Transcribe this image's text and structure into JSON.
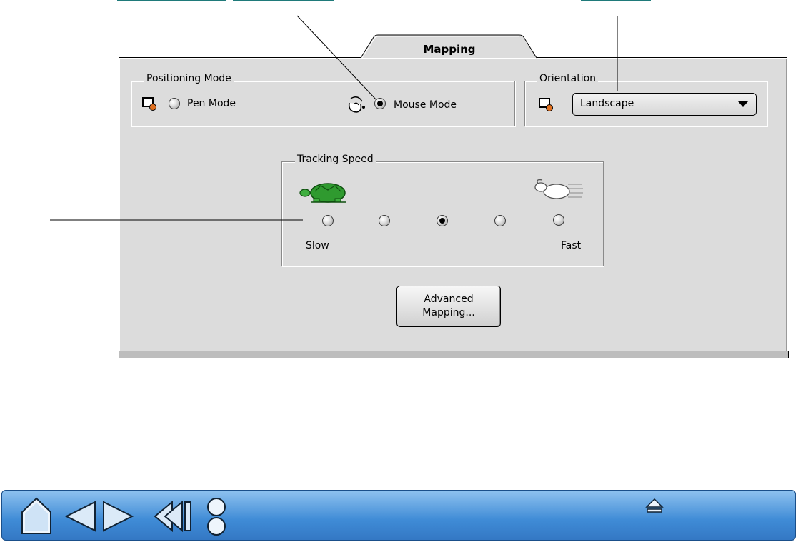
{
  "tab": {
    "label": "Mapping"
  },
  "positioning_mode": {
    "title": "Positioning Mode",
    "options": [
      {
        "label": "Pen Mode",
        "selected": false,
        "icon": "tablet-pen-icon"
      },
      {
        "label": "Mouse Mode",
        "selected": true,
        "icon": "mouse-icon"
      }
    ]
  },
  "orientation": {
    "title": "Orientation",
    "selected_value": "Landscape",
    "icon": "tablet-pen-icon"
  },
  "tracking_speed": {
    "title": "Tracking Speed",
    "min_label": "Slow",
    "max_label": "Fast",
    "levels": 5,
    "selected_level": 3,
    "icons": [
      "turtle-icon",
      "rabbit-icon"
    ]
  },
  "advanced_button": {
    "line1": "Advanced",
    "line2": "Mapping..."
  },
  "navigation": {
    "buttons": [
      "home-icon",
      "previous-page-icon",
      "next-page-icon",
      "back-icon",
      "contents-index-icon",
      "top-of-section-icon"
    ],
    "accent_color": "#3f8bd6"
  }
}
